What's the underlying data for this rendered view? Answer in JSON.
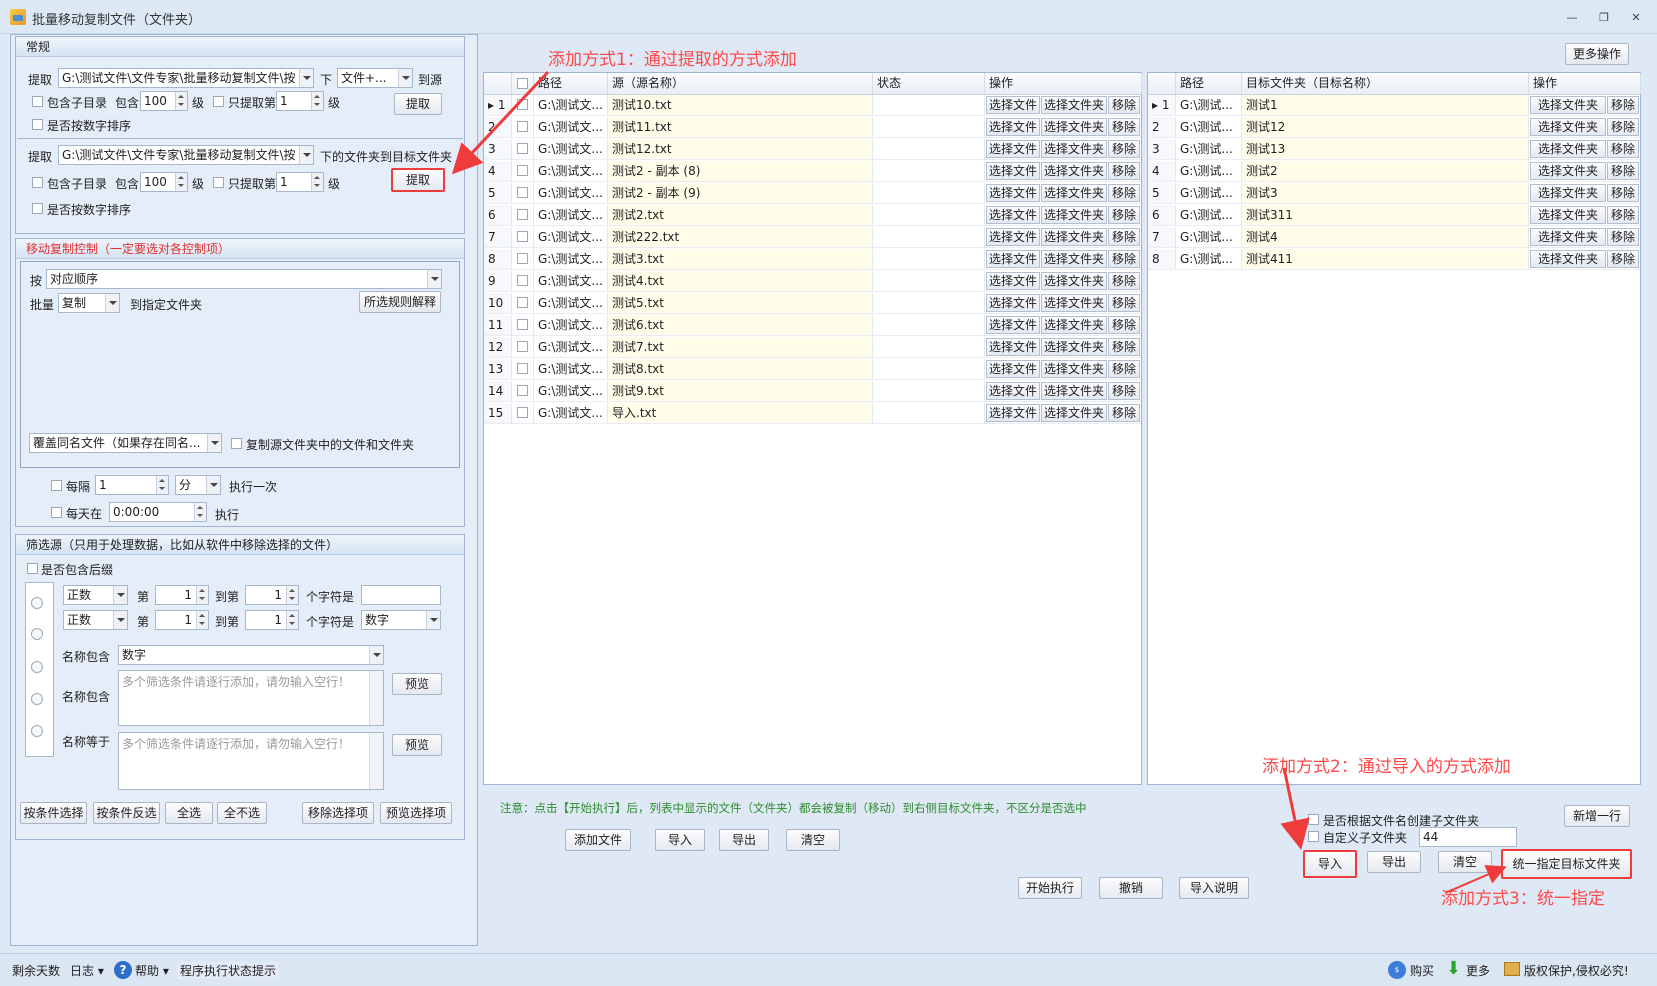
{
  "window": {
    "title": "批量移动复制文件（文件夹）"
  },
  "general": {
    "header": "常规",
    "extract": "提取",
    "path1": "G:\\测试文件\\文件专家\\批量移动复制文件\\按",
    "lower": "下",
    "file_plus": "文件+...",
    "to_source": "到源",
    "include_sub": "包含子目录",
    "include": "包含",
    "level_val": "100",
    "level": "级",
    "only_extract": "只提取第",
    "only_val": "1",
    "sort_num": "是否按数字排序",
    "extract_btn": "提取",
    "path2": "G:\\测试文件\\文件专家\\批量移动复制文件\\按",
    "folder_to_target": "下的文件夹到目标文件夹"
  },
  "control": {
    "header": "移动复制控制（一定要选对各控制项）",
    "by": "按",
    "order": "对应顺序",
    "batch": "批量",
    "copy": "复制",
    "to_folder": "到指定文件夹",
    "explain_btn": "所选规则解释",
    "overwrite": "覆盖同名文件（如果存在同名...",
    "copy_src": "复制源文件夹中的文件和文件夹"
  },
  "timer": {
    "every": "每隔",
    "every_val": "1",
    "unit": "分",
    "exec_once": "执行一次",
    "daily": "每天在",
    "daily_val": "0:00:00",
    "exec": "执行"
  },
  "filter": {
    "header": "筛选源（只用于处理数据，比如从软件中移除选择的文件）",
    "include_ext": "是否包含后缀",
    "mode1": "正数",
    "mode2": "正数",
    "nth": "第",
    "to_nth": "到第",
    "v1": "1",
    "v2": "1",
    "v3": "1",
    "v4": "1",
    "chars_is": "个字符是",
    "digit": "数字",
    "name_contains": "名称包含",
    "name_contains2": "名称包含",
    "name_equals": "名称等于",
    "hint": "多个筛选条件请逐行添加，请勿输入空行！",
    "preview": "预览",
    "btn_by_cond": "按条件选择",
    "btn_rev": "按条件反选",
    "btn_all": "全选",
    "btn_none": "全不选",
    "btn_remove": "移除选择项",
    "btn_preview_sel": "预览选择项"
  },
  "left_grid": {
    "headers": [
      "路径",
      "源（源名称）",
      "状态",
      "操作"
    ],
    "ops": [
      "选择文件",
      "选择文件夹",
      "移除"
    ],
    "rows": [
      {
        "n": "1",
        "path": "G:\\测试文...",
        "name": "测试10.txt"
      },
      {
        "n": "2",
        "path": "G:\\测试文...",
        "name": "测试11.txt"
      },
      {
        "n": "3",
        "path": "G:\\测试文...",
        "name": "测试12.txt"
      },
      {
        "n": "4",
        "path": "G:\\测试文...",
        "name": "测试2 - 副本 (8)"
      },
      {
        "n": "5",
        "path": "G:\\测试文...",
        "name": "测试2 - 副本 (9)"
      },
      {
        "n": "6",
        "path": "G:\\测试文...",
        "name": "测试2.txt"
      },
      {
        "n": "7",
        "path": "G:\\测试文...",
        "name": "测试222.txt"
      },
      {
        "n": "8",
        "path": "G:\\测试文...",
        "name": "测试3.txt"
      },
      {
        "n": "9",
        "path": "G:\\测试文...",
        "name": "测试4.txt"
      },
      {
        "n": "10",
        "path": "G:\\测试文...",
        "name": "测试5.txt"
      },
      {
        "n": "11",
        "path": "G:\\测试文...",
        "name": "测试6.txt"
      },
      {
        "n": "12",
        "path": "G:\\测试文...",
        "name": "测试7.txt"
      },
      {
        "n": "13",
        "path": "G:\\测试文...",
        "name": "测试8.txt"
      },
      {
        "n": "14",
        "path": "G:\\测试文...",
        "name": "测试9.txt"
      },
      {
        "n": "15",
        "path": "G:\\测试文...",
        "name": "导入.txt"
      }
    ]
  },
  "right_grid": {
    "headers": [
      "路径",
      "目标文件夹（目标名称）",
      "操作"
    ],
    "ops": [
      "选择文件夹",
      "移除"
    ],
    "rows": [
      {
        "n": "1",
        "path": "G:\\测试...",
        "name": "测试1"
      },
      {
        "n": "2",
        "path": "G:\\测试...",
        "name": "测试12"
      },
      {
        "n": "3",
        "path": "G:\\测试...",
        "name": "测试13"
      },
      {
        "n": "4",
        "path": "G:\\测试...",
        "name": "测试2"
      },
      {
        "n": "5",
        "path": "G:\\测试...",
        "name": "测试3"
      },
      {
        "n": "6",
        "path": "G:\\测试...",
        "name": "测试311"
      },
      {
        "n": "7",
        "path": "G:\\测试...",
        "name": "测试4"
      },
      {
        "n": "8",
        "path": "G:\\测试...",
        "name": "测试411"
      }
    ]
  },
  "more_ops": "更多操作",
  "note": "注意：点击【开始执行】后，列表中显示的文件（文件夹）都会被复制（移动）到右侧目标文件夹，不区分是否选中",
  "left_actions": {
    "add_file": "添加文件",
    "import": "导入",
    "export": "导出",
    "clear": "清空"
  },
  "right_actions": {
    "create_sub": "是否根据文件名创建子文件夹",
    "custom_sub": "自定义子文件夹",
    "custom_val": "44",
    "new_row": "新增一行",
    "import": "导入",
    "export": "导出",
    "clear": "清空",
    "unify": "统一指定目标文件夹"
  },
  "exec_actions": {
    "start": "开始执行",
    "cancel": "撤销",
    "import_help": "导入说明"
  },
  "annotations": {
    "a1": "添加方式1：通过提取的方式添加",
    "a2": "添加方式2：通过导入的方式添加",
    "a3": "添加方式3：统一指定"
  },
  "status": {
    "days": "剩余天数",
    "log": "日志",
    "help": "帮助",
    "state": "程序执行状态提示",
    "buy": "购买",
    "more": "更多",
    "copyright": "版权保护,侵权必究!"
  },
  "colors": {
    "accent_red": "#ff4a4a",
    "control_header": "#e03030",
    "note_green": "#2e8b2e"
  }
}
